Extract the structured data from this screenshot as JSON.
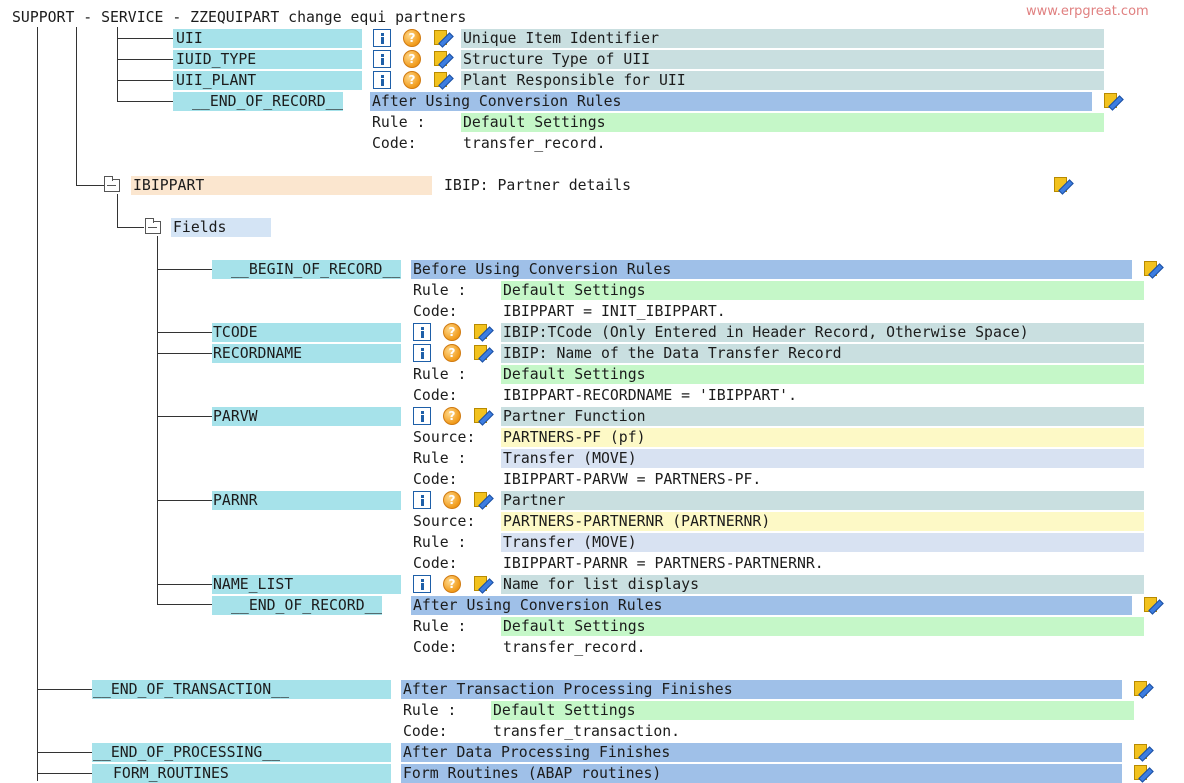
{
  "window": {
    "title": "SUPPORT - SERVICE - ZZEQUIPART change equi partners",
    "watermark": "www.erpgreat.com"
  },
  "labels": {
    "rule": "Rule :",
    "code": "Code:",
    "source": "Source:"
  },
  "icons": {
    "info": "info-icon",
    "help": "help-icon",
    "help_glyph": "?",
    "edit": "edit-rule-icon",
    "folder": "folder-icon"
  },
  "top": {
    "uii": {
      "field": "UII",
      "desc": "Unique Item Identifier"
    },
    "iuid_type": {
      "field": "IUID_TYPE",
      "desc": "Structure Type of UII"
    },
    "uii_plant": {
      "field": "UII_PLANT",
      "desc": "Plant Responsible for UII"
    },
    "end_of_record": {
      "field": "__END_OF_RECORD__",
      "desc": "After Using Conversion Rules",
      "rule": "Default Settings",
      "code": "transfer_record."
    }
  },
  "ibippart": {
    "name": "IBIPPART",
    "desc": "IBIP: Partner details",
    "fields_label": "Fields",
    "begin_of_record": {
      "field": "__BEGIN_OF_RECORD__",
      "desc": "Before Using Conversion Rules",
      "rule": "Default Settings",
      "code": "IBIPPART = INIT_IBIPPART."
    },
    "tcode": {
      "field": "TCODE",
      "desc": "IBIP:TCode (Only Entered in Header Record, Otherwise Space)"
    },
    "recordname": {
      "field": "RECORDNAME",
      "desc": "IBIP: Name of the Data Transfer Record",
      "rule": "Default Settings",
      "code": "IBIPPART-RECORDNAME = 'IBIPPART'."
    },
    "parvw": {
      "field": "PARVW",
      "desc": "Partner Function",
      "source": "PARTNERS-PF (pf)",
      "rule": "Transfer (MOVE)",
      "code": "IBIPPART-PARVW = PARTNERS-PF."
    },
    "parnr": {
      "field": "PARNR",
      "desc": "Partner",
      "source": "PARTNERS-PARTNERNR (PARTNERNR)",
      "rule": "Transfer (MOVE)",
      "code": "IBIPPART-PARNR = PARTNERS-PARTNERNR."
    },
    "name_list": {
      "field": "NAME_LIST",
      "desc": "Name for list displays"
    },
    "end_of_record": {
      "field": "__END_OF_RECORD__",
      "desc": "After Using Conversion Rules",
      "rule": "Default Settings",
      "code": "transfer_record."
    }
  },
  "end_of_transaction": {
    "field": "__END_OF_TRANSACTION__",
    "desc": "After Transaction Processing Finishes",
    "rule": "Default Settings",
    "code": "transfer_transaction."
  },
  "end_of_processing": {
    "field": "__END_OF_PROCESSING__",
    "desc": "After Data Processing Finishes"
  },
  "form_routines": {
    "field": "FORM_ROUTINES",
    "desc": "Form Routines (ABAP routines)"
  }
}
